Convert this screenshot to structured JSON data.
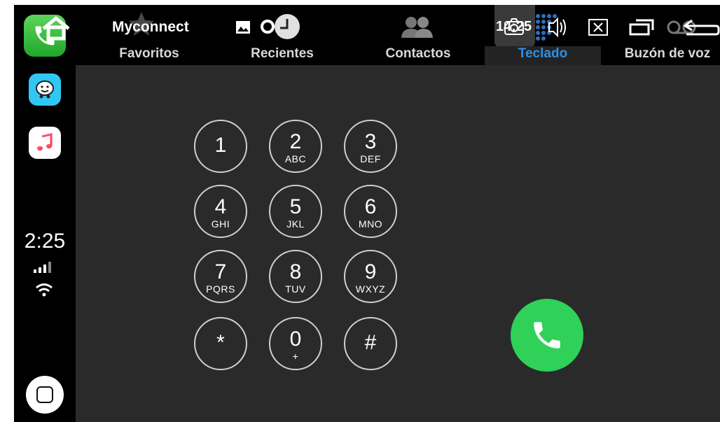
{
  "sidebar": {
    "apps": [
      {
        "name": "Teléfono",
        "icon": "phone-app-icon"
      },
      {
        "name": "Waze",
        "icon": "waze-app-icon"
      },
      {
        "name": "Música",
        "icon": "music-app-icon"
      }
    ],
    "time": "2:25",
    "signal_icon": "cellular-signal-icon",
    "wifi_icon": "wifi-icon",
    "home_icon": "home-button-icon"
  },
  "header": {
    "app_title": "Myconnect",
    "status_time": "14:25",
    "icons": [
      "home-overlay-icon",
      "star-icon",
      "image-icon",
      "toggle-icon",
      "contacts-icon",
      "camera-icon",
      "speaker-icon",
      "close-box-icon",
      "window-icon",
      "voicemail-back-icon"
    ]
  },
  "tabs": [
    {
      "label": "Favoritos",
      "active": false
    },
    {
      "label": "Recientes",
      "active": false
    },
    {
      "label": "Contactos",
      "active": false
    },
    {
      "label": "Teclado",
      "active": true
    },
    {
      "label": "Buzón de voz",
      "active": false
    }
  ],
  "keypad": [
    {
      "digit": "1",
      "letters": ""
    },
    {
      "digit": "2",
      "letters": "ABC"
    },
    {
      "digit": "3",
      "letters": "DEF"
    },
    {
      "digit": "4",
      "letters": "GHI"
    },
    {
      "digit": "5",
      "letters": "JKL"
    },
    {
      "digit": "6",
      "letters": "MNO"
    },
    {
      "digit": "7",
      "letters": "PQRS"
    },
    {
      "digit": "8",
      "letters": "TUV"
    },
    {
      "digit": "9",
      "letters": "WXYZ"
    },
    {
      "digit": "*",
      "letters": ""
    },
    {
      "digit": "0",
      "letters": "+"
    },
    {
      "digit": "#",
      "letters": ""
    }
  ],
  "call_button": {
    "icon": "phone-call-icon",
    "color": "#2fd158"
  },
  "colors": {
    "accent": "#2e8fe6",
    "background": "#2a2a2a"
  }
}
